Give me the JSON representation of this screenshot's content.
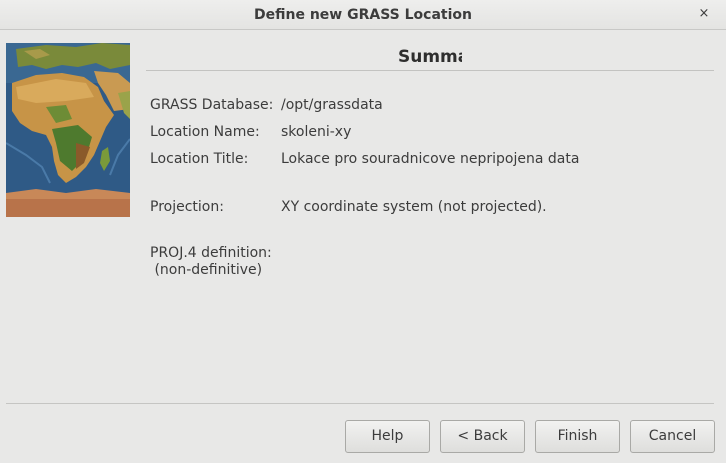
{
  "window": {
    "title": "Define new GRASS Location",
    "close_glyph": "×"
  },
  "image": {
    "icon": "world-map-africa-icon"
  },
  "summary": {
    "heading": "Summa",
    "rows": [
      {
        "label": "GRASS Database:",
        "value": "/opt/grassdata"
      },
      {
        "label": "Location Name:",
        "value": "skoleni-xy"
      },
      {
        "label": "Location Title:",
        "value": "Lokace pro souradnicove nepripojena data"
      },
      {
        "label": "Projection:",
        "value": "XY coordinate system (not projected)."
      }
    ],
    "proj_label_line1": "PROJ.4 definition:",
    "proj_label_line2": " (non-definitive)"
  },
  "buttons": {
    "help": "Help",
    "back": "< Back",
    "finish": "Finish",
    "cancel": "Cancel"
  }
}
